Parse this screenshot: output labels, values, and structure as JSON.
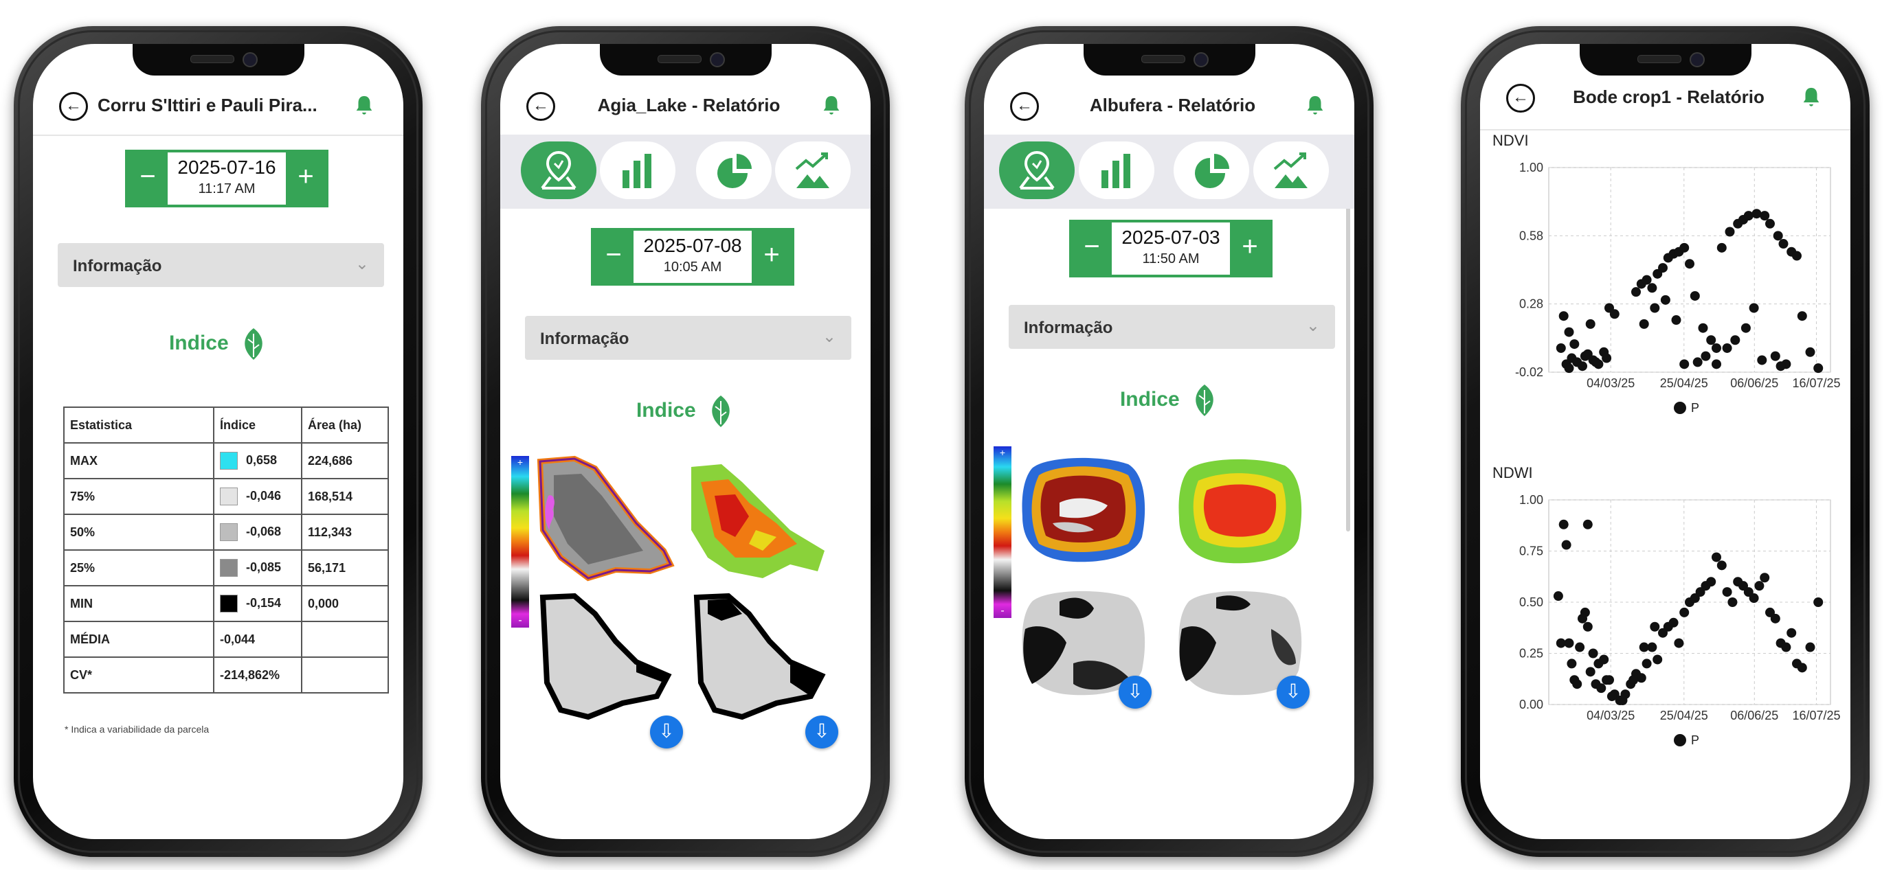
{
  "colors": {
    "green": "#36a456",
    "blue": "#1877e6"
  },
  "icons": {
    "back": "back-arrow-circle-icon",
    "bell": "bell-icon",
    "leaf": "leaf-icon",
    "download": "download-icon"
  },
  "phone1": {
    "title": "Corru S'Ittiri e Pauli Pira...",
    "date": "2025-07-16",
    "time": "11:17 AM",
    "minus": "−",
    "plus": "+",
    "accordion": "Informação",
    "indice": "Indice",
    "table": {
      "headers": [
        "Estatistica",
        "Índice",
        "Área (ha)"
      ],
      "rows": [
        {
          "label": "MAX",
          "value": "0,658",
          "area": "224,686",
          "color": "#2de0f0"
        },
        {
          "label": "75%",
          "value": "-0,046",
          "area": "168,514",
          "color": "#e4e4e4"
        },
        {
          "label": "50%",
          "value": "-0,068",
          "area": "112,343",
          "color": "#bdbdbd"
        },
        {
          "label": "25%",
          "value": "-0,085",
          "area": "56,171",
          "color": "#8a8a8a"
        },
        {
          "label": "MIN",
          "value": "-0,154",
          "area": "0,000",
          "color": "#000000"
        },
        {
          "label": "MÉDIA",
          "value": "-0,044",
          "area": ""
        },
        {
          "label": "CV*",
          "value": "-214,862%",
          "area": ""
        }
      ]
    },
    "footnote": "* Indica a variabilidade da parcela"
  },
  "phone2": {
    "title": "Agia_Lake - Relatório",
    "date": "2025-07-08",
    "time": "10:05 AM",
    "minus": "−",
    "plus": "+",
    "accordion": "Informação",
    "indice": "Indice",
    "legend_plus": "+",
    "legend_minus": "-"
  },
  "phone3": {
    "title": "Albufera - Relatório",
    "date": "2025-07-03",
    "time": "11:50 AM",
    "minus": "−",
    "plus": "+",
    "accordion": "Informação",
    "indice": "Indice",
    "legend_plus": "+",
    "legend_minus": "-"
  },
  "phone4": {
    "title": "Bode crop1 - Relatório",
    "ndvi_label": "NDVI",
    "ndwi_label": "NDWI"
  },
  "chart_data": [
    {
      "type": "scatter",
      "title": "NDVI",
      "x_ticks": [
        "04/03/25",
        "25/04/25",
        "06/06/25",
        "16/07/25"
      ],
      "y_ticks": [
        "1.00",
        "0.58",
        "0.28",
        "-0.02"
      ],
      "ylim": [
        -0.02,
        1.0
      ],
      "legend": [
        "P"
      ],
      "series": [
        {
          "name": "P",
          "x": [
            0.02,
            0.04,
            0.05,
            0.06,
            0.08,
            0.1,
            0.12,
            0.14,
            0.16,
            0.18,
            0.2,
            0.22,
            0.03,
            0.07,
            0.11,
            0.15,
            0.19,
            0.3,
            0.32,
            0.34,
            0.36,
            0.38,
            0.4,
            0.42,
            0.44,
            0.46,
            0.48,
            0.5,
            0.52,
            0.33,
            0.37,
            0.41,
            0.45,
            0.55,
            0.58,
            0.6,
            0.62,
            0.65,
            0.68,
            0.7,
            0.72,
            0.75,
            0.78,
            0.8,
            0.83,
            0.85,
            0.88,
            0.9,
            0.56,
            0.6,
            0.64,
            0.67,
            0.71,
            0.74,
            0.77,
            0.82,
            0.86,
            0.92,
            0.95,
            0.98,
            0.05,
            0.13,
            0.48,
            0.53,
            0.84
          ],
          "y": [
            0.1,
            0.02,
            0.0,
            0.05,
            0.03,
            0.01,
            0.07,
            0.04,
            0.02,
            0.08,
            0.3,
            0.27,
            0.26,
            0.12,
            0.06,
            0.03,
            0.05,
            0.38,
            0.42,
            0.44,
            0.4,
            0.47,
            0.5,
            0.55,
            0.57,
            0.58,
            0.6,
            0.52,
            0.36,
            0.22,
            0.3,
            0.34,
            0.24,
            0.2,
            0.14,
            0.1,
            0.6,
            0.68,
            0.72,
            0.74,
            0.76,
            0.77,
            0.76,
            0.72,
            0.66,
            0.62,
            0.58,
            0.56,
            0.06,
            0.02,
            0.1,
            0.14,
            0.2,
            0.3,
            0.04,
            0.06,
            0.02,
            0.26,
            0.08,
            0.0,
            0.18,
            0.22,
            0.02,
            0.03,
            0.01
          ]
        }
      ]
    },
    {
      "type": "scatter",
      "title": "NDWI",
      "x_ticks": [
        "04/03/25",
        "25/04/25",
        "06/06/25",
        "16/07/25"
      ],
      "y_ticks": [
        "1.00",
        "0.75",
        "0.50",
        "0.25",
        "0.00"
      ],
      "ylim": [
        0,
        1.0
      ],
      "legend": [
        "P"
      ],
      "series": [
        {
          "name": "P",
          "x": [
            0.01,
            0.03,
            0.04,
            0.05,
            0.06,
            0.07,
            0.08,
            0.09,
            0.1,
            0.11,
            0.12,
            0.13,
            0.14,
            0.16,
            0.18,
            0.2,
            0.22,
            0.24,
            0.26,
            0.28,
            0.3,
            0.32,
            0.34,
            0.36,
            0.38,
            0.4,
            0.42,
            0.44,
            0.46,
            0.48,
            0.5,
            0.52,
            0.54,
            0.56,
            0.58,
            0.6,
            0.62,
            0.64,
            0.66,
            0.68,
            0.7,
            0.72,
            0.74,
            0.76,
            0.78,
            0.8,
            0.82,
            0.84,
            0.86,
            0.88,
            0.9,
            0.92,
            0.95,
            0.98,
            0.15,
            0.17,
            0.21,
            0.25,
            0.29,
            0.33,
            0.37,
            0.02,
            0.12,
            0.19
          ],
          "y": [
            0.53,
            0.88,
            0.78,
            0.3,
            0.2,
            0.12,
            0.1,
            0.28,
            0.42,
            0.45,
            0.38,
            0.16,
            0.25,
            0.2,
            0.22,
            0.12,
            0.05,
            0.02,
            0.05,
            0.1,
            0.15,
            0.13,
            0.2,
            0.28,
            0.22,
            0.35,
            0.38,
            0.4,
            0.3,
            0.45,
            0.5,
            0.52,
            0.55,
            0.58,
            0.6,
            0.72,
            0.68,
            0.55,
            0.5,
            0.6,
            0.58,
            0.55,
            0.52,
            0.58,
            0.62,
            0.45,
            0.42,
            0.3,
            0.28,
            0.35,
            0.2,
            0.18,
            0.28,
            0.5,
            0.1,
            0.08,
            0.04,
            0.02,
            0.12,
            0.28,
            0.38,
            0.3,
            0.88,
            0.12
          ]
        }
      ]
    }
  ]
}
